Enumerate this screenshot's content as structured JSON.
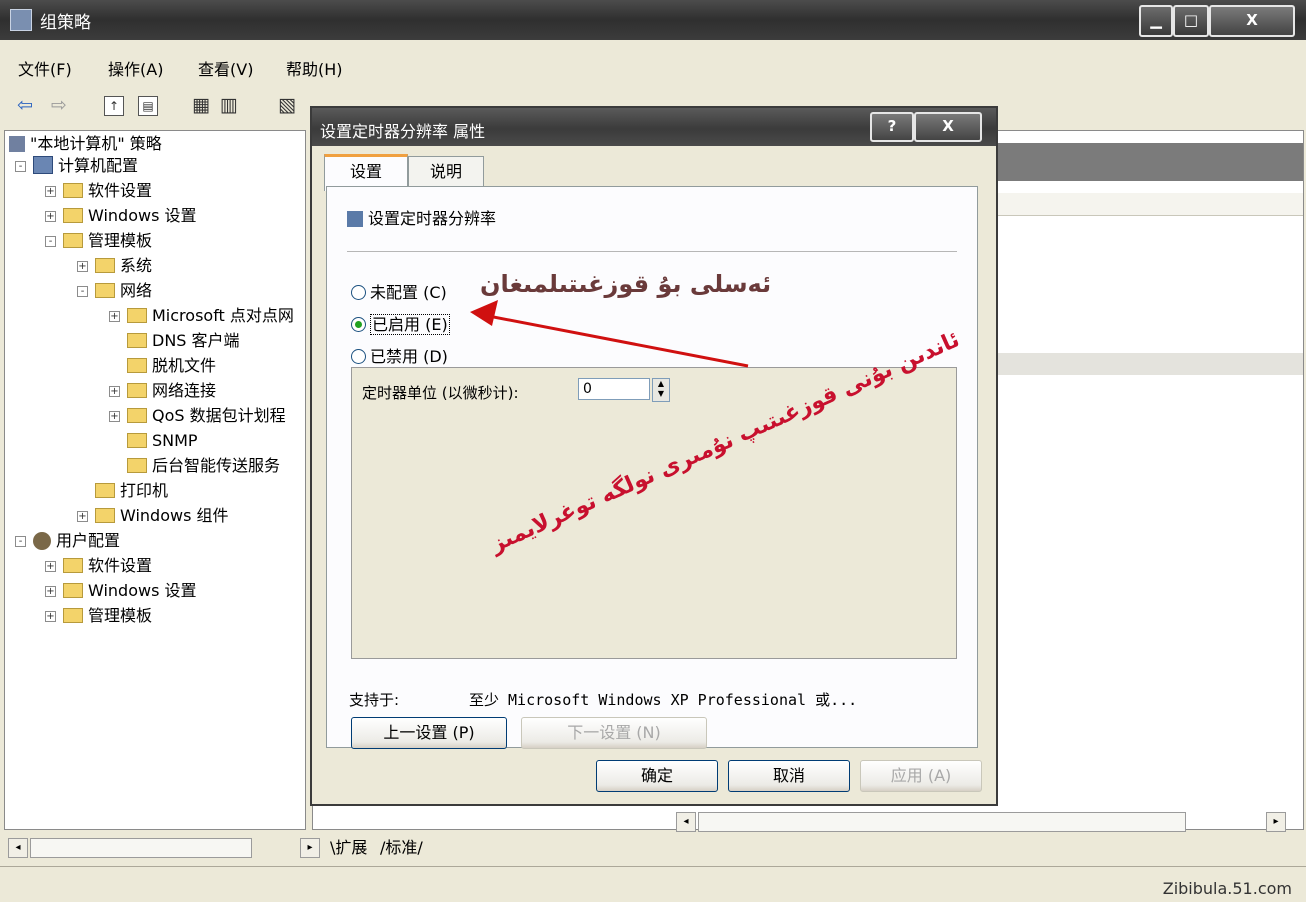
{
  "window": {
    "title": "组策略",
    "minimize": "▁",
    "maximize": "□",
    "close": "X"
  },
  "menu": [
    "文件(F)",
    "操作(A)",
    "查看(V)",
    "帮助(H)"
  ],
  "tree": {
    "root": "\"本地计算机\" 策略",
    "items": [
      {
        "label": "计算机配置",
        "pm": "-"
      },
      {
        "label": "软件设置",
        "pm": "+"
      },
      {
        "label": "Windows 设置",
        "pm": "+"
      },
      {
        "label": "管理模板",
        "pm": "-"
      },
      {
        "label": "系统",
        "pm": "+"
      },
      {
        "label": "网络",
        "pm": "-"
      },
      {
        "label": "Microsoft 点对点网",
        "pm": "+"
      },
      {
        "label": "DNS 客户端",
        "pm": ""
      },
      {
        "label": "脱机文件",
        "pm": ""
      },
      {
        "label": "网络连接",
        "pm": "+"
      },
      {
        "label": "QoS 数据包计划程",
        "pm": "+"
      },
      {
        "label": "SNMP",
        "pm": ""
      },
      {
        "label": "后台智能传送服务",
        "pm": ""
      },
      {
        "label": "打印机",
        "pm": ""
      },
      {
        "label": "Windows 组件",
        "pm": "+"
      },
      {
        "label": "用户配置",
        "pm": "-"
      },
      {
        "label": "软件设置",
        "pm": "+"
      },
      {
        "label": "Windows 设置",
        "pm": "+"
      },
      {
        "label": "管理模板",
        "pm": "+"
      }
    ]
  },
  "bottom_tabs": [
    "扩展",
    "标准"
  ],
  "watermark": "Zibibula.51.com",
  "dialog": {
    "title": "设置定时器分辨率 属性",
    "help": "?",
    "close": "X",
    "tabs": [
      "设置",
      "说明"
    ],
    "setting_name": "设置定时器分辨率",
    "options": {
      "not_configured": "未配置 (C)",
      "enabled": "已启用 (E)",
      "disabled": "已禁用 (D)",
      "selected": "enabled"
    },
    "timer_label": "定时器单位 (以微秒计):",
    "timer_value": "0",
    "supported_label": "支持于:",
    "supported_value": "至少 Microsoft Windows XP Professional 或...",
    "prev_button": "上一设置 (P)",
    "next_button": "下一设置 (N)",
    "ok": "确定",
    "cancel": "取消",
    "apply": "应用 (A)"
  },
  "annotations": {
    "line1": "ئەسلى بۇ قوزغىتىلمىغان",
    "line2": "ئاندىن بۇنى قوزغىتىپ نۇمىرى نولگە توغرلايمىز"
  }
}
